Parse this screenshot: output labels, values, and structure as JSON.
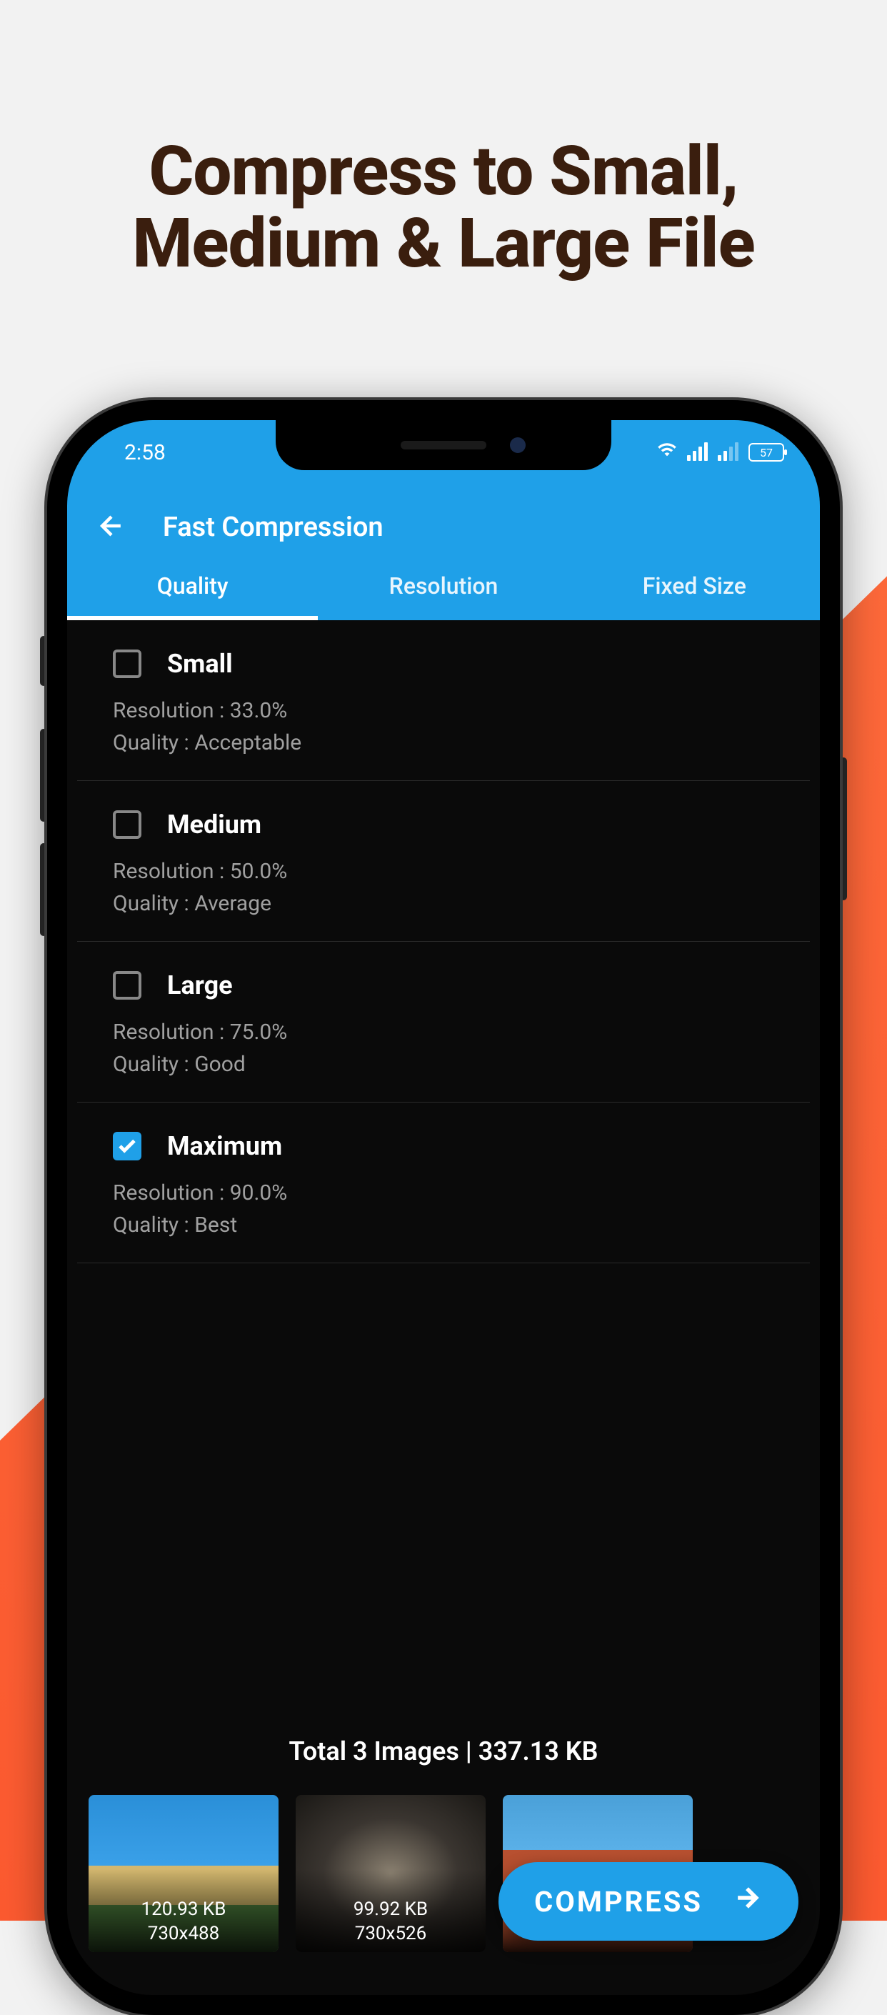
{
  "headline_line1": "Compress to Small,",
  "headline_line2": "Medium & Large File",
  "statusbar": {
    "time": "2:58",
    "battery": "57"
  },
  "appbar": {
    "title": "Fast Compression"
  },
  "tabs": [
    {
      "label": "Quality",
      "active": true
    },
    {
      "label": "Resolution",
      "active": false
    },
    {
      "label": "Fixed Size",
      "active": false
    }
  ],
  "options": [
    {
      "label": "Small",
      "resolution": "Resolution : 33.0%",
      "quality": "Quality : Acceptable",
      "checked": false
    },
    {
      "label": "Medium",
      "resolution": "Resolution : 50.0%",
      "quality": "Quality : Average",
      "checked": false
    },
    {
      "label": "Large",
      "resolution": "Resolution : 75.0%",
      "quality": "Quality : Good",
      "checked": false
    },
    {
      "label": "Maximum",
      "resolution": "Resolution : 90.0%",
      "quality": "Quality : Best",
      "checked": true
    }
  ],
  "summary": "Total 3 Images | 337.13 KB",
  "thumbs": [
    {
      "size": "120.93 KB",
      "dims": "730x488"
    },
    {
      "size": "99.92 KB",
      "dims": "730x526"
    },
    {
      "size": "",
      "dims": ""
    }
  ],
  "compress_label": "COMPRESS"
}
